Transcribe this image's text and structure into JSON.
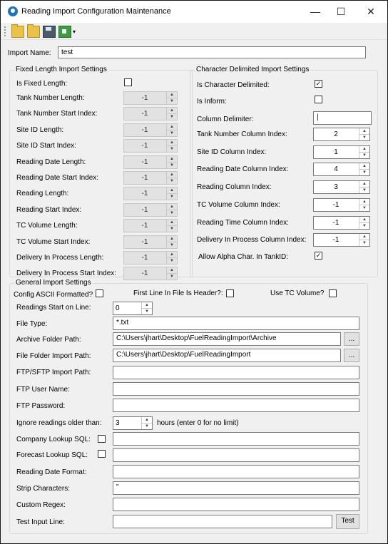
{
  "window": {
    "title": "Reading Import Configuration Maintenance",
    "minimize": "—",
    "maximize": "☐",
    "close": "✕"
  },
  "toolbar": {
    "icons": [
      "open-folder-icon",
      "open-folder-icon",
      "save-icon",
      "export-icon"
    ],
    "overflow": "▾"
  },
  "import_name": {
    "label": "Import Name:",
    "value": "test"
  },
  "fixed": {
    "title": "Fixed Length Import Settings",
    "is_fixed": {
      "label": "Is Fixed Length:",
      "checked": false
    },
    "fields": [
      {
        "label": "Tank Number Length:",
        "value": "-1"
      },
      {
        "label": "Tank Number Start Index:",
        "value": "-1"
      },
      {
        "label": "Site ID Length:",
        "value": "-1"
      },
      {
        "label": "Site ID Start Index:",
        "value": "-1"
      },
      {
        "label": "Reading Date Length:",
        "value": "-1"
      },
      {
        "label": "Reading Date Start Index:",
        "value": "-1"
      },
      {
        "label": "Reading Length:",
        "value": "-1"
      },
      {
        "label": "Reading Start Index:",
        "value": "-1"
      },
      {
        "label": "TC Volume Length:",
        "value": "-1"
      },
      {
        "label": "TC Volume Start Index:",
        "value": "-1"
      },
      {
        "label": "Delivery In Process Length:",
        "value": "-1"
      },
      {
        "label": "Delivery In Process Start Index:",
        "value": "-1"
      }
    ]
  },
  "delim": {
    "title": "Character Delimited Import Settings",
    "is_char_delim": {
      "label": "Is Character Delimited:",
      "checked": true
    },
    "is_inform": {
      "label": "Is Inform:",
      "checked": false
    },
    "column_delimiter": {
      "label": "Column Delimiter:",
      "value": "|"
    },
    "fields": [
      {
        "label": "Tank Number Column Index:",
        "value": "2"
      },
      {
        "label": "Site ID Column Index:",
        "value": "1"
      },
      {
        "label": "Reading Date Column Index:",
        "value": "4"
      },
      {
        "label": "Reading Column Index:",
        "value": "3"
      },
      {
        "label": "TC Volume Column Index:",
        "value": "-1"
      },
      {
        "label": "Reading Time Column Index:",
        "value": "-1"
      },
      {
        "label": "Delivery In Process Column Index:",
        "value": "-1"
      }
    ],
    "allow_alpha": {
      "label": "Allow Alpha Char. In TankID:",
      "checked": true
    }
  },
  "general": {
    "title": "General Import Settings",
    "config_ascii": {
      "label": "Config ASCII Formatted?",
      "checked": false
    },
    "first_line_header": {
      "label": "First Line In File Is Header?:",
      "checked": false
    },
    "use_tc_volume": {
      "label": "Use TC Volume?",
      "checked": false
    },
    "readings_start": {
      "label": "Readings Start on Line:",
      "value": "0"
    },
    "file_type": {
      "label": "File Type:",
      "value": "*.txt"
    },
    "archive_path": {
      "label": "Archive Folder Path:",
      "value": "C:\\Users\\jhart\\Desktop\\FuelReadingImport\\Archive",
      "browse": "..."
    },
    "import_path": {
      "label": "File Folder Import Path:",
      "value": "C:\\Users\\jhart\\Desktop\\FuelReadingImport",
      "browse": "..."
    },
    "ftp_path": {
      "label": "FTP/SFTP Import Path:",
      "value": ""
    },
    "ftp_user": {
      "label": "FTP User Name:",
      "value": ""
    },
    "ftp_password": {
      "label": "FTP Password:",
      "value": ""
    },
    "ignore_older": {
      "label": "Ignore readings older than:",
      "value": "3",
      "suffix": "hours (enter 0 for no limit)"
    },
    "company_sql": {
      "label": "Company Lookup SQL:",
      "checked": false,
      "value": ""
    },
    "forecast_sql": {
      "label": "Forecast Lookup SQL:",
      "checked": false,
      "value": ""
    },
    "date_format": {
      "label": "Reading Date Format:",
      "value": ""
    },
    "strip_chars": {
      "label": "Strip Characters:",
      "value": "\""
    },
    "custom_regex": {
      "label": "Custom Regex:",
      "value": ""
    },
    "test_input": {
      "label": "Test Input Line:",
      "value": "",
      "button": "Test"
    }
  }
}
